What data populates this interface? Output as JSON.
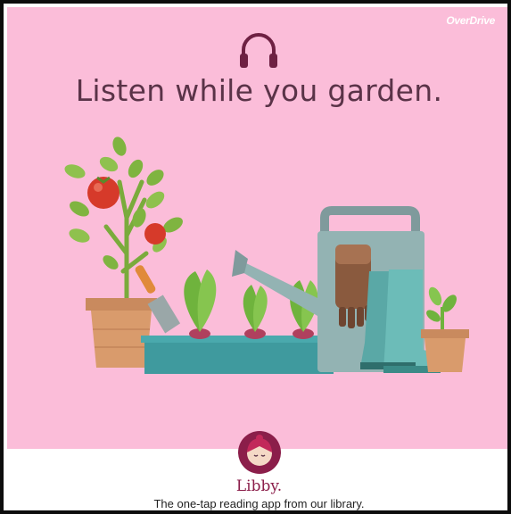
{
  "brand": {
    "name": "OverDrive"
  },
  "headline": "Listen while you garden.",
  "app": {
    "name": "Libby.",
    "tagline": "The one-tap reading app from our library."
  },
  "icons": {
    "top": "headphones-icon",
    "logo": "libby-logo-icon"
  },
  "colors": {
    "background": "#fbbdd9",
    "headline": "#5a3348",
    "accent": "#8b1e4a",
    "footer": "#ffffff"
  }
}
